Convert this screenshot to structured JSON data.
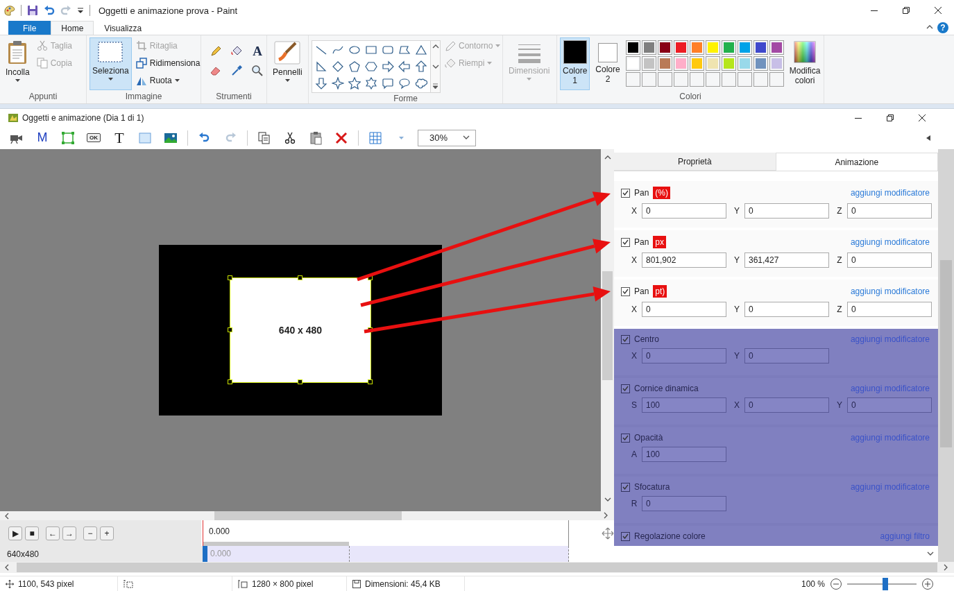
{
  "app": {
    "title": "Oggetti e animazione prova - Paint",
    "help": "?"
  },
  "ribbon_tabs": [
    {
      "label": "File",
      "kind": "file",
      "selected": false
    },
    {
      "label": "Home",
      "kind": "tab",
      "selected": true
    },
    {
      "label": "Visualizza",
      "kind": "tab",
      "selected": false
    }
  ],
  "clipboard": {
    "label": "Appunti",
    "paste": "Incolla",
    "items": [
      {
        "label": "Taglia",
        "kind": "cut",
        "disabled": true
      },
      {
        "label": "Copia",
        "kind": "copy",
        "disabled": true
      }
    ]
  },
  "image": {
    "label": "Immagine",
    "select": {
      "label": "Seleziona",
      "selected": true
    },
    "items": [
      {
        "label": "Ritaglia",
        "kind": "crop",
        "disabled": true
      },
      {
        "label": "Ridimensiona",
        "kind": "resize",
        "disabled": false
      },
      {
        "label": "Ruota",
        "kind": "rotate",
        "disabled": false
      }
    ]
  },
  "tools": {
    "label": "Strumenti",
    "items": [
      {
        "kind": "pencil"
      },
      {
        "kind": "fill"
      },
      {
        "kind": "text",
        "glyph": "A"
      },
      {
        "kind": "eraser"
      },
      {
        "kind": "picker"
      },
      {
        "kind": "magnifier"
      }
    ]
  },
  "brushes": {
    "label": "Pennelli"
  },
  "shapes": {
    "label": "Forme",
    "items": [
      {
        "label": "Contorno",
        "kind": "outline",
        "disabled": true
      },
      {
        "label": "Riempi",
        "kind": "fill",
        "disabled": true
      }
    ]
  },
  "size": {
    "label": "Dimensioni",
    "disabled": true
  },
  "colors": {
    "label": "Colori",
    "slots": [
      {
        "label": "Colore 1",
        "color": "#000000",
        "selected": true
      },
      {
        "label": "Colore 2",
        "color": "#ffffff",
        "selected": false
      }
    ],
    "palette": [
      {
        "color": "#000000"
      },
      {
        "color": "#7f7f7f"
      },
      {
        "color": "#880015"
      },
      {
        "color": "#ed1c24"
      },
      {
        "color": "#ff7f27"
      },
      {
        "color": "#fff200"
      },
      {
        "color": "#22b14c"
      },
      {
        "color": "#00a2e8"
      },
      {
        "color": "#3f48cc"
      },
      {
        "color": "#a349a4"
      },
      {
        "color": "#ffffff"
      },
      {
        "color": "#c3c3c3"
      },
      {
        "color": "#b97a57"
      },
      {
        "color": "#ffaec9"
      },
      {
        "color": "#ffc90e"
      },
      {
        "color": "#efe4b0"
      },
      {
        "color": "#b5e61d"
      },
      {
        "color": "#99d9ea"
      },
      {
        "color": "#7092be"
      },
      {
        "color": "#c8bfe7"
      }
    ],
    "edit": "Modifica colori"
  },
  "document": {
    "title": "Oggetti e animazione (Dia 1 di 1)",
    "zoom": "30%",
    "toolbar": [
      {
        "kind": "camera"
      },
      {
        "kind": "glyph",
        "glyph": "M"
      },
      {
        "kind": "frame"
      },
      {
        "kind": "button",
        "glyph": "OK"
      },
      {
        "kind": "serif",
        "glyph": "T"
      },
      {
        "kind": "rectangle"
      },
      {
        "kind": "picture"
      },
      {
        "kind": "separator"
      },
      {
        "kind": "undo"
      },
      {
        "kind": "redo"
      },
      {
        "kind": "separator"
      },
      {
        "kind": "copy"
      },
      {
        "kind": "cut"
      },
      {
        "kind": "paste"
      },
      {
        "kind": "delete"
      },
      {
        "kind": "separator"
      },
      {
        "kind": "grid"
      }
    ]
  },
  "canvas": {
    "object_label": "640 x 480"
  },
  "panel": {
    "tabs": [
      {
        "label": "Proprietà",
        "selected": false
      },
      {
        "label": "Animazione",
        "selected": true
      }
    ],
    "sections": [
      {
        "title": "Pan",
        "unit": "(%)",
        "checked": true,
        "highlighted": false,
        "link": "aggiungi modificatore",
        "fields": [
          {
            "label": "X",
            "value": "0"
          },
          {
            "label": "Y",
            "value": "0"
          },
          {
            "label": "Z",
            "value": "0"
          }
        ]
      },
      {
        "title": "Pan",
        "unit": "px",
        "checked": true,
        "highlighted": false,
        "link": "aggiungi modificatore",
        "fields": [
          {
            "label": "X",
            "value": "801,902"
          },
          {
            "label": "Y",
            "value": "361,427"
          },
          {
            "label": "Z",
            "value": "0"
          }
        ]
      },
      {
        "title": "Pan",
        "unit": "pt)",
        "checked": true,
        "highlighted": false,
        "link": "aggiungi modificatore",
        "fields": [
          {
            "label": "X",
            "value": "0"
          },
          {
            "label": "Y",
            "value": "0"
          },
          {
            "label": "Z",
            "value": "0"
          }
        ]
      },
      {
        "title": "Centro",
        "checked": true,
        "highlighted": true,
        "link": "aggiungi modificatore",
        "fields": [
          {
            "label": "X",
            "value": "0"
          },
          {
            "label": "Y",
            "value": "0"
          }
        ]
      },
      {
        "title": "Cornice dinamica",
        "checked": true,
        "highlighted": true,
        "link": "aggiungi modificatore",
        "fields": [
          {
            "label": "S",
            "value": "100"
          },
          {
            "label": "X",
            "value": "0"
          },
          {
            "label": "Y",
            "value": "0"
          }
        ]
      },
      {
        "title": "Opacità",
        "checked": true,
        "highlighted": true,
        "link": "aggiungi modificatore",
        "fields": [
          {
            "label": "A",
            "value": "100"
          }
        ]
      },
      {
        "title": "Sfocatura",
        "checked": true,
        "highlighted": true,
        "link": "aggiungi modificatore",
        "fields": [
          {
            "label": "R",
            "value": "0"
          }
        ]
      },
      {
        "title": "Regolazione colore",
        "checked": true,
        "highlighted": true,
        "link": "aggiungi filtro"
      }
    ]
  },
  "timeline": {
    "buttons": [
      "▶",
      "■",
      "←",
      "→",
      "−",
      "+"
    ],
    "time": "0.000",
    "track": "640x480",
    "track_time": "0.000"
  },
  "status": {
    "position": "1100, 543 pixel",
    "image_size": "1280 × 800 pixel",
    "file_size": "Dimensioni: 45,4 KB",
    "zoom": "100 %",
    "zoom_slider": {
      "level": 0.55
    }
  }
}
